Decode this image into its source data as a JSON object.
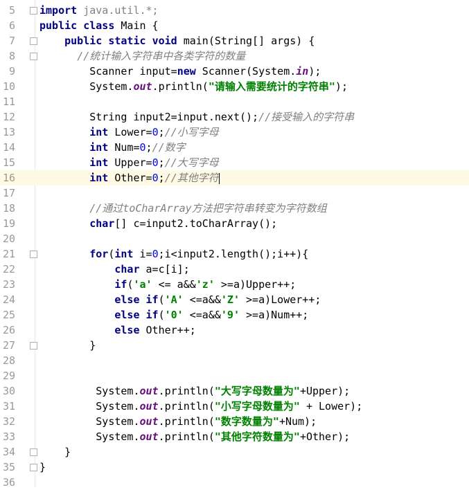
{
  "editor": {
    "current_line": 16,
    "lines": [
      {
        "n": "5",
        "tokens": [
          {
            "t": "import",
            "c": "kw"
          },
          {
            "t": " java.util.*;",
            "c": "imp"
          }
        ]
      },
      {
        "n": "6",
        "tokens": [
          {
            "t": "public",
            "c": "kw"
          },
          {
            "t": " "
          },
          {
            "t": "class",
            "c": "kw"
          },
          {
            "t": " Main {"
          }
        ]
      },
      {
        "n": "7",
        "tokens": [
          {
            "t": "    "
          },
          {
            "t": "public",
            "c": "kw"
          },
          {
            "t": " "
          },
          {
            "t": "static",
            "c": "kw"
          },
          {
            "t": " "
          },
          {
            "t": "void",
            "c": "kw"
          },
          {
            "t": " main(String[] args) {"
          }
        ]
      },
      {
        "n": "8",
        "tokens": [
          {
            "t": "      "
          },
          {
            "t": "//统计输入字符串中各类字符的数量",
            "c": "cm"
          }
        ]
      },
      {
        "n": "9",
        "tokens": [
          {
            "t": "        Scanner input="
          },
          {
            "t": "new",
            "c": "kw"
          },
          {
            "t": " Scanner(System."
          },
          {
            "t": "in",
            "c": "st"
          },
          {
            "t": ");"
          }
        ]
      },
      {
        "n": "10",
        "tokens": [
          {
            "t": "        System."
          },
          {
            "t": "out",
            "c": "st"
          },
          {
            "t": ".println("
          },
          {
            "t": "\"请输入需要统计的字符串\"",
            "c": "str"
          },
          {
            "t": ");"
          }
        ]
      },
      {
        "n": "11",
        "tokens": []
      },
      {
        "n": "12",
        "tokens": [
          {
            "t": "        String input2=input.next();"
          },
          {
            "t": "//接受输入的字符串",
            "c": "cm"
          }
        ]
      },
      {
        "n": "13",
        "tokens": [
          {
            "t": "        "
          },
          {
            "t": "int",
            "c": "kw"
          },
          {
            "t": " Lower="
          },
          {
            "t": "0",
            "c": "num"
          },
          {
            "t": ";"
          },
          {
            "t": "//小写字母",
            "c": "cm"
          }
        ]
      },
      {
        "n": "14",
        "tokens": [
          {
            "t": "        "
          },
          {
            "t": "int",
            "c": "kw"
          },
          {
            "t": " Num="
          },
          {
            "t": "0",
            "c": "num"
          },
          {
            "t": ";"
          },
          {
            "t": "//数字",
            "c": "cm"
          }
        ]
      },
      {
        "n": "15",
        "tokens": [
          {
            "t": "        "
          },
          {
            "t": "int",
            "c": "kw"
          },
          {
            "t": " Upper="
          },
          {
            "t": "0",
            "c": "num"
          },
          {
            "t": ";"
          },
          {
            "t": "//大写字母",
            "c": "cm"
          }
        ]
      },
      {
        "n": "16",
        "tokens": [
          {
            "t": "        "
          },
          {
            "t": "int",
            "c": "kw"
          },
          {
            "t": " Other="
          },
          {
            "t": "0",
            "c": "num"
          },
          {
            "t": ";"
          },
          {
            "t": "//其他字符",
            "c": "cm"
          }
        ]
      },
      {
        "n": "17",
        "tokens": []
      },
      {
        "n": "18",
        "tokens": [
          {
            "t": "        "
          },
          {
            "t": "//通过toCharArray方法把字符串转变为字符数组",
            "c": "cm"
          }
        ]
      },
      {
        "n": "19",
        "tokens": [
          {
            "t": "        "
          },
          {
            "t": "char",
            "c": "kw"
          },
          {
            "t": "[] c=input2.toCharArray();"
          }
        ]
      },
      {
        "n": "20",
        "tokens": []
      },
      {
        "n": "21",
        "tokens": [
          {
            "t": "        "
          },
          {
            "t": "for",
            "c": "kw"
          },
          {
            "t": "("
          },
          {
            "t": "int",
            "c": "kw"
          },
          {
            "t": " i="
          },
          {
            "t": "0",
            "c": "num"
          },
          {
            "t": ";i<input2.length();i++){"
          }
        ]
      },
      {
        "n": "22",
        "tokens": [
          {
            "t": "            "
          },
          {
            "t": "char",
            "c": "kw"
          },
          {
            "t": " a=c[i];"
          }
        ]
      },
      {
        "n": "23",
        "tokens": [
          {
            "t": "            "
          },
          {
            "t": "if",
            "c": "kw"
          },
          {
            "t": "("
          },
          {
            "t": "'a'",
            "c": "str"
          },
          {
            "t": " <= a&&"
          },
          {
            "t": "'z'",
            "c": "str"
          },
          {
            "t": " >=a)Upper++;"
          }
        ]
      },
      {
        "n": "24",
        "tokens": [
          {
            "t": "            "
          },
          {
            "t": "else if",
            "c": "kw"
          },
          {
            "t": "("
          },
          {
            "t": "'A'",
            "c": "str"
          },
          {
            "t": " <=a&&"
          },
          {
            "t": "'Z'",
            "c": "str"
          },
          {
            "t": " >=a)Lower++;"
          }
        ]
      },
      {
        "n": "25",
        "tokens": [
          {
            "t": "            "
          },
          {
            "t": "else if",
            "c": "kw"
          },
          {
            "t": "("
          },
          {
            "t": "'0'",
            "c": "str"
          },
          {
            "t": " <=a&&"
          },
          {
            "t": "'9'",
            "c": "str"
          },
          {
            "t": " >=a)Num++;"
          }
        ]
      },
      {
        "n": "26",
        "tokens": [
          {
            "t": "            "
          },
          {
            "t": "else",
            "c": "kw"
          },
          {
            "t": " Other++;"
          }
        ]
      },
      {
        "n": "27",
        "tokens": [
          {
            "t": "        }"
          }
        ]
      },
      {
        "n": "28",
        "tokens": []
      },
      {
        "n": "29",
        "tokens": []
      },
      {
        "n": "30",
        "tokens": [
          {
            "t": "         System."
          },
          {
            "t": "out",
            "c": "st"
          },
          {
            "t": ".println("
          },
          {
            "t": "\"大写字母数量为\"",
            "c": "str"
          },
          {
            "t": "+Upper);"
          }
        ]
      },
      {
        "n": "31",
        "tokens": [
          {
            "t": "         System."
          },
          {
            "t": "out",
            "c": "st"
          },
          {
            "t": ".println("
          },
          {
            "t": "\"小写字母数量为\"",
            "c": "str"
          },
          {
            "t": " + Lower);"
          }
        ]
      },
      {
        "n": "32",
        "tokens": [
          {
            "t": "         System."
          },
          {
            "t": "out",
            "c": "st"
          },
          {
            "t": ".println("
          },
          {
            "t": "\"数字数量为\"",
            "c": "str"
          },
          {
            "t": "+Num);"
          }
        ]
      },
      {
        "n": "33",
        "tokens": [
          {
            "t": "         System."
          },
          {
            "t": "out",
            "c": "st"
          },
          {
            "t": ".println("
          },
          {
            "t": "\"其他字符数量为\"",
            "c": "str"
          },
          {
            "t": "+Other);"
          }
        ]
      },
      {
        "n": "34",
        "tokens": [
          {
            "t": "    }"
          }
        ]
      },
      {
        "n": "35",
        "tokens": [
          {
            "t": "}"
          }
        ]
      },
      {
        "n": "36",
        "tokens": []
      }
    ]
  }
}
